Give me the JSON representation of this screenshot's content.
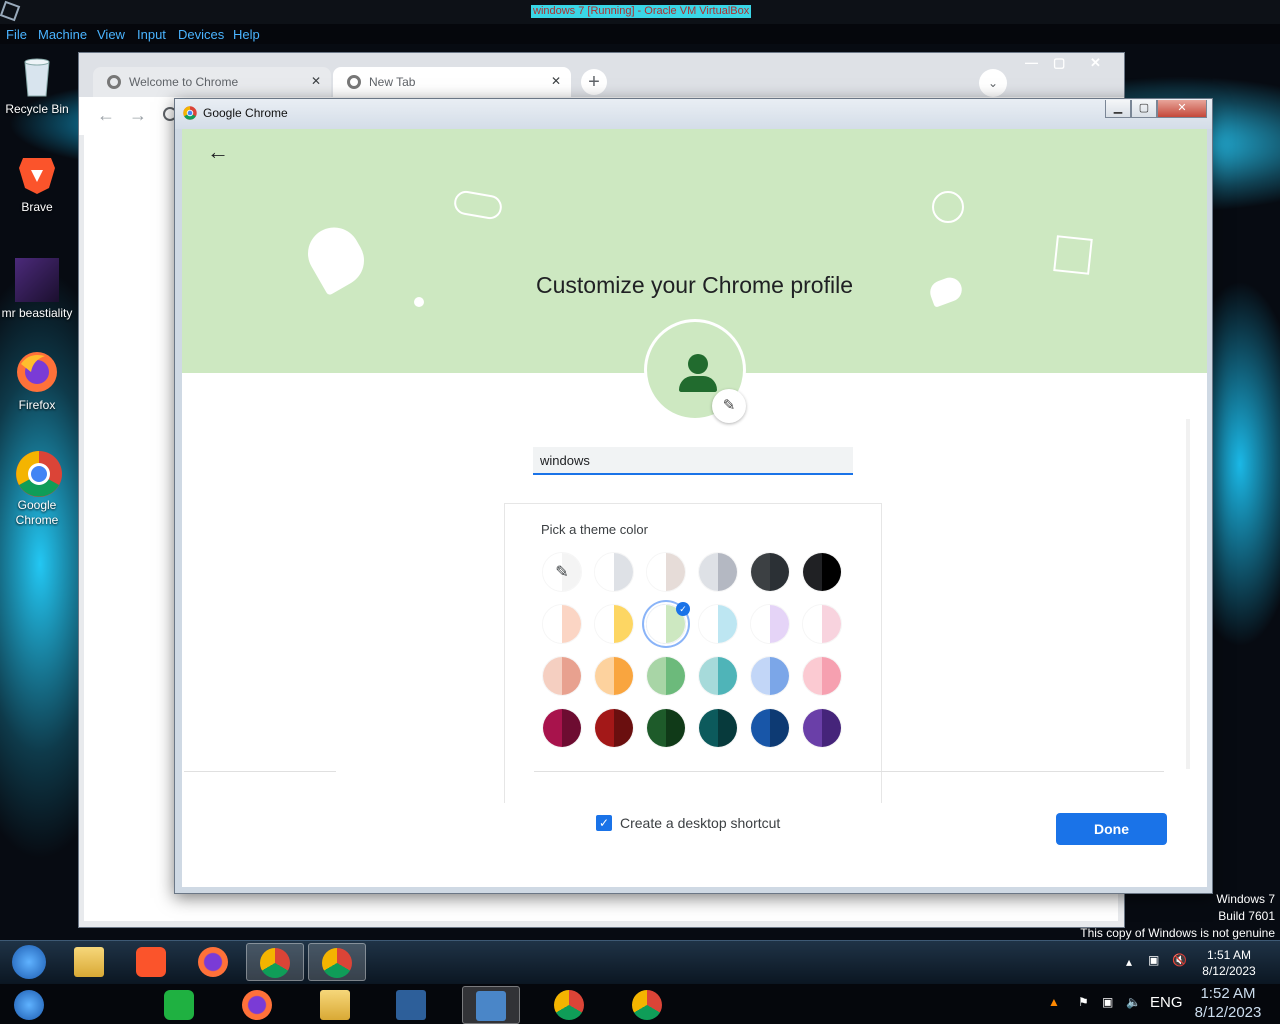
{
  "vm": {
    "title": "windows 7 [Running] - Oracle VM VirtualBox",
    "menu": [
      "File",
      "Machine",
      "View",
      "Input",
      "Devices",
      "Help"
    ]
  },
  "desktop_icons": [
    {
      "label": "Recycle Bin",
      "icon": "recycle-bin-icon"
    },
    {
      "label": "Brave",
      "icon": "brave-icon"
    },
    {
      "label": "mr beastiality",
      "icon": "image-file-icon"
    },
    {
      "label": "Firefox",
      "icon": "firefox-icon"
    },
    {
      "label": "Google Chrome",
      "icon": "chrome-icon"
    }
  ],
  "browser": {
    "tabs": [
      {
        "label": "Welcome to Chrome"
      },
      {
        "label": "New Tab"
      }
    ],
    "new_tab": "+",
    "tab_close": "✕",
    "back": "←",
    "forward": "→"
  },
  "dialog": {
    "title": "Google Chrome",
    "back_glyph": "←",
    "heading": "Customize your Chrome profile",
    "name_value": "windows",
    "theme_label": "Pick a theme color",
    "shortcut_label": "Create a desktop shortcut",
    "done_label": "Done",
    "colors": {
      "banner": "#cde8c1",
      "accent": "#1a73e8",
      "avatar_figure": "#216b2e"
    },
    "swatches": [
      [
        {
          "left": "#ffffff",
          "right": "#f4f4f4",
          "icon": "eyedropper-icon"
        },
        {
          "left": "#ffffff",
          "right": "#dee1e6"
        },
        {
          "left": "#ffffff",
          "right": "#e6dcd8"
        },
        {
          "left": "#dee1e6",
          "right": "#b4b8c2"
        },
        {
          "left": "#3c4043",
          "right": "#2b3035"
        },
        {
          "left": "#202124",
          "right": "#000000"
        }
      ],
      [
        {
          "left": "#ffffff",
          "right": "#fbd5c4"
        },
        {
          "left": "#ffffff",
          "right": "#fdd663"
        },
        {
          "left": "#ffffff",
          "right": "#cde8c1",
          "selected": true
        },
        {
          "left": "#ffffff",
          "right": "#bde6f2"
        },
        {
          "left": "#ffffff",
          "right": "#e5d4f7"
        },
        {
          "left": "#ffffff",
          "right": "#f8d3de"
        }
      ],
      [
        {
          "left": "#f5cfc1",
          "right": "#e8a18f"
        },
        {
          "left": "#fdd29e",
          "right": "#f9a53f"
        },
        {
          "left": "#a8d5a6",
          "right": "#6cba7b"
        },
        {
          "left": "#a6dada",
          "right": "#4fb4b8"
        },
        {
          "left": "#c2d6f7",
          "right": "#7ba6e8"
        },
        {
          "left": "#fbcad2",
          "right": "#f6a0b0"
        }
      ],
      [
        {
          "left": "#a8134c",
          "right": "#6d0c31"
        },
        {
          "left": "#a31818",
          "right": "#6a0f0f"
        },
        {
          "left": "#1e5b2a",
          "right": "#103a18"
        },
        {
          "left": "#0c5a5c",
          "right": "#073a3c"
        },
        {
          "left": "#1856a8",
          "right": "#0d3a73"
        },
        {
          "left": "#6a3fa8",
          "right": "#45247a"
        }
      ]
    ]
  },
  "watermark": {
    "line1": "Windows 7",
    "line2": "Build 7601",
    "line3": "This copy of Windows is not genuine"
  },
  "taskbar_guest": {
    "time": "1:51 AM",
    "date": "8/12/2023",
    "apps": [
      "start-orb-icon",
      "file-explorer-icon",
      "brave-icon",
      "firefox-icon",
      "chrome-icon",
      "chrome-icon"
    ]
  },
  "taskbar_host": {
    "time": "1:52 AM",
    "date": "8/12/2023",
    "lang": "ENG",
    "apps": [
      "start-orb-icon",
      "notes-icon",
      "firefox-icon",
      "file-explorer-icon",
      "virtualbox-icon",
      "windows7-vm-icon",
      "chrome-icon",
      "chrome-profile-icon"
    ]
  }
}
